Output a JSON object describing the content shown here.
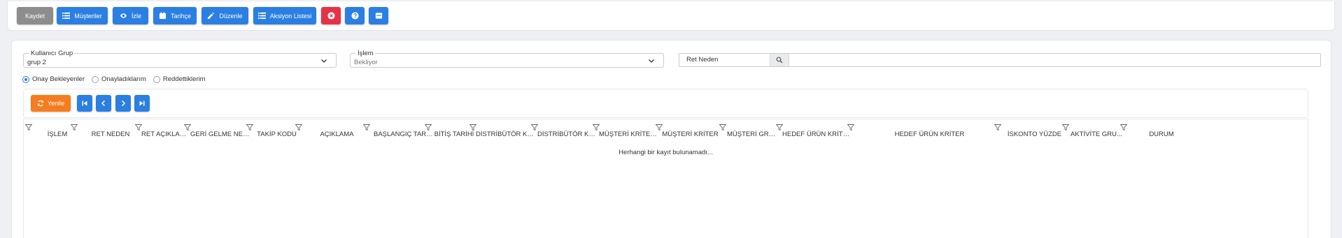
{
  "toolbar": {
    "save_label": "Kaydet",
    "customers_label": "Müşteriler",
    "track_label": "İzle",
    "history_label": "Tarihçe",
    "edit_label": "Düzenle",
    "action_list_label": "Aksiyon Listesi"
  },
  "filters": {
    "user_group": {
      "label": "Kullanıcı Grup",
      "value": "grup 2"
    },
    "process": {
      "label": "İşlem",
      "value": "Bekliyor"
    },
    "reject_reason": {
      "label": "Ret Neden",
      "value": ""
    }
  },
  "radios": [
    {
      "label": "Onay Bekleyenler",
      "checked": true
    },
    {
      "label": "Onayladıklarım",
      "checked": false
    },
    {
      "label": "Reddettiklerim",
      "checked": false
    }
  ],
  "grid_toolbar": {
    "refresh_label": "Yenile"
  },
  "grid": {
    "columns": [
      "İŞLEM",
      "RET NEDEN",
      "RET AÇIKLAMA",
      "GERİ GELME NEDENİ",
      "TAKİP KODU",
      "AÇIKLAMA",
      "BAŞLANGIÇ TARİHİ",
      "BİTİŞ TARİHİ",
      "DİSTRİBÜTÖR KRİTE...",
      "DİSTRİBÜTÖR KRİTE...",
      "MÜŞTERİ KRİTER TİPİ",
      "MÜŞTERİ KRİTER",
      "MÜŞTERİ GRUP",
      "HEDEF ÜRÜN KRİTE...",
      "HEDEF ÜRÜN KRİTER",
      "İSKONTO YÜZDE",
      "AKTİVİTE GRU...",
      "DURUM"
    ],
    "empty_message": "Herhangi bir kayıt bulunamadı..."
  },
  "colors": {
    "primary": "#2b7fe3",
    "danger": "#e53246",
    "neutral": "#8d8d8d",
    "refresh": "#f57c1f"
  }
}
